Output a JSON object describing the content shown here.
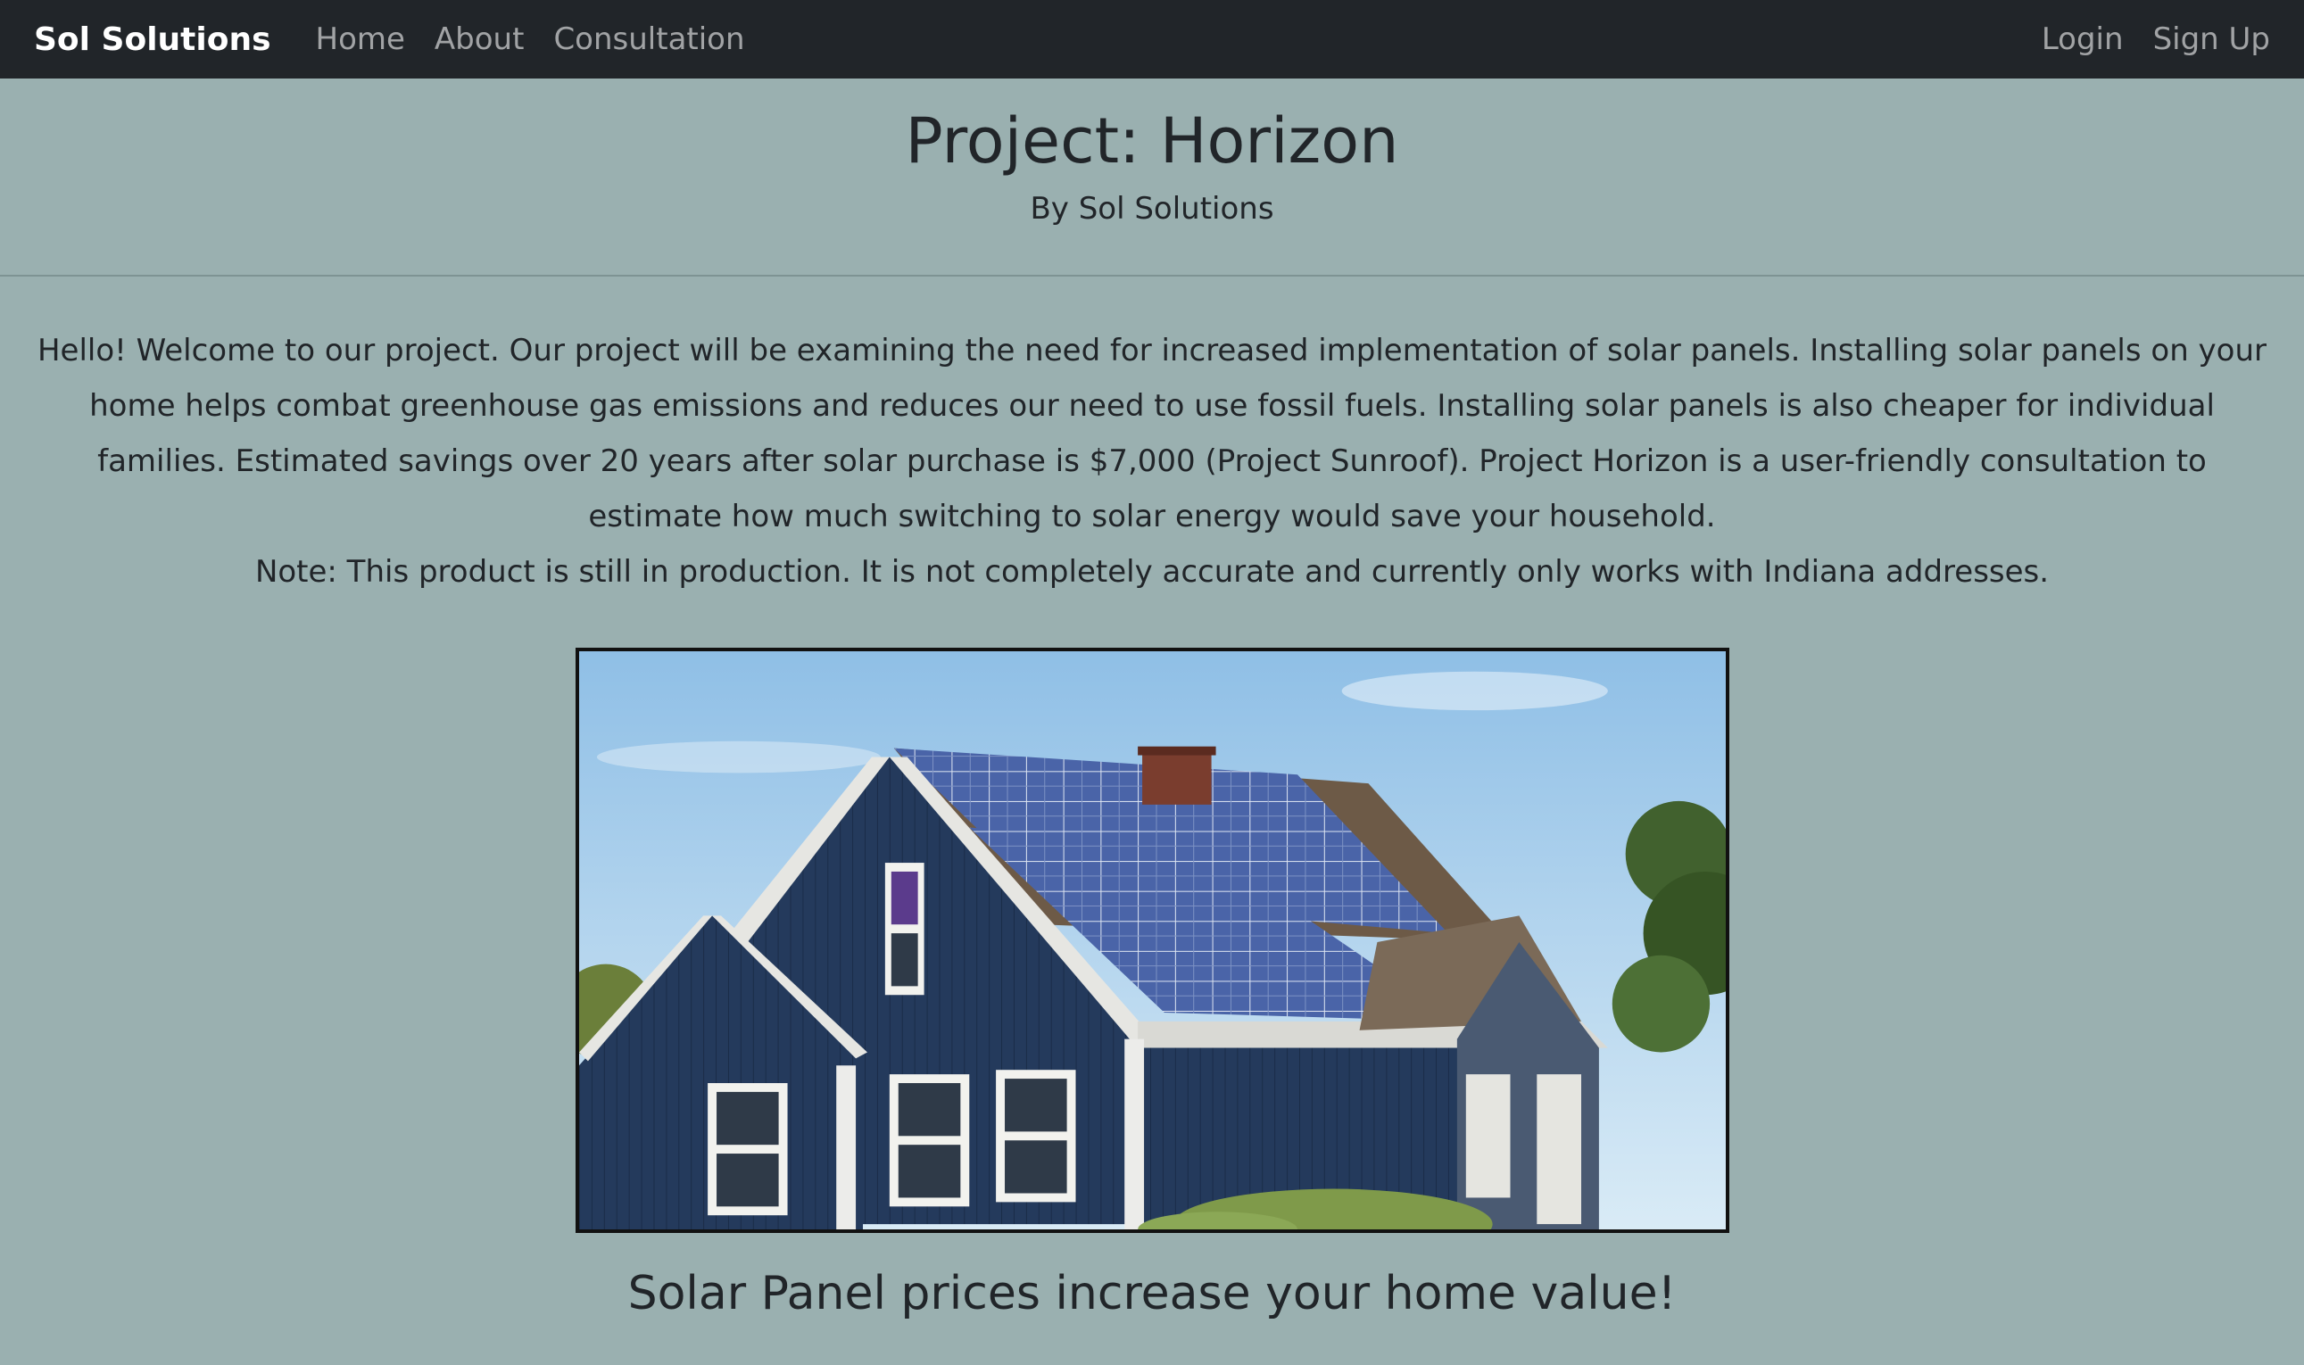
{
  "navbar": {
    "brand": "Sol Solutions",
    "links": [
      "Home",
      "About",
      "Consultation"
    ],
    "right_links": [
      "Login",
      "Sign Up"
    ]
  },
  "header": {
    "title": "Project: Horizon",
    "subtitle": "By Sol Solutions"
  },
  "intro": {
    "paragraph": "Hello! Welcome to our project. Our project will be examining the need for increased implementation of solar panels. Installing solar panels on your home helps combat greenhouse gas emissions and reduces our need to use fossil fuels. Installing solar panels is also cheaper for individual families. Estimated savings over 20 years after solar purchase is $7,000 (Project Sunroof). Project Horizon is a user-friendly consultation to estimate how much switching to solar energy would save your household.",
    "note": "Note: This product is still in production. It is not completely accurate and currently only works with Indiana addresses."
  },
  "hero_image": {
    "subject": "blue-house-with-solar-panels"
  },
  "tagline": "Solar Panel prices increase your home value!",
  "colors": {
    "page_background": "#9ab0b0",
    "navbar_background": "#212529",
    "house_siding": "#243a5c",
    "solar_panel": "#4a64a8",
    "sky": "#a9cdea"
  }
}
